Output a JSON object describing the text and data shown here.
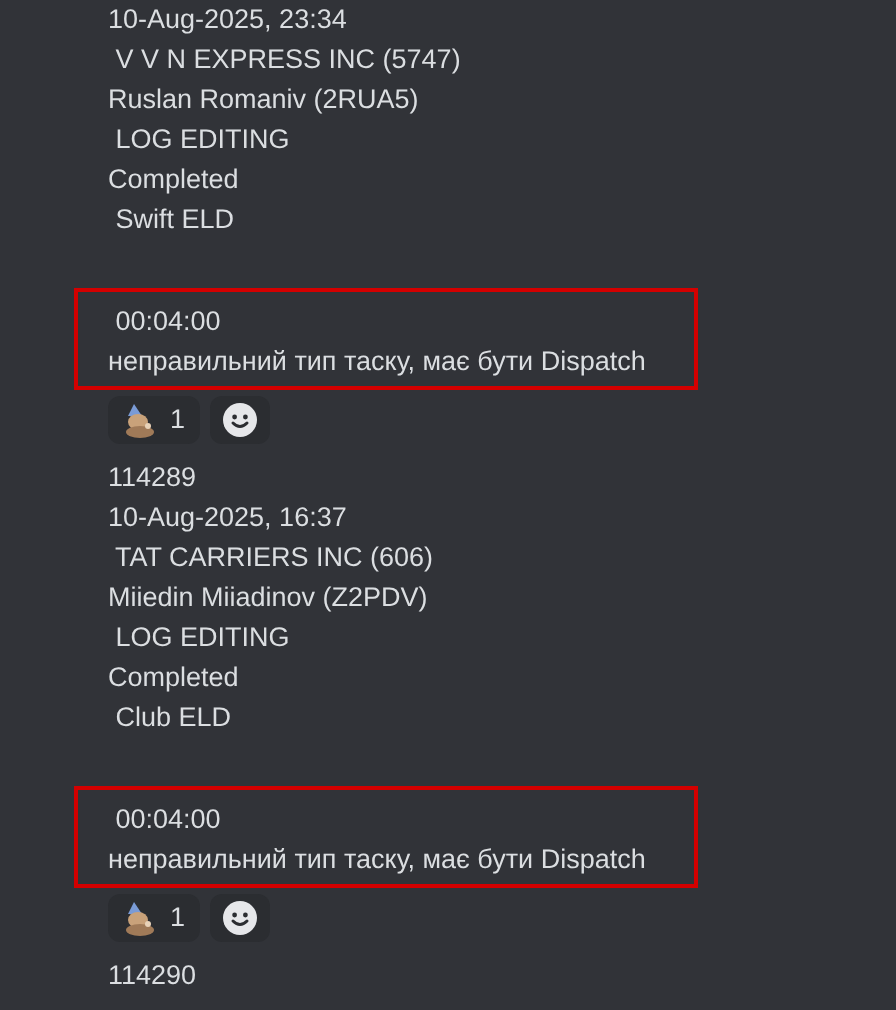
{
  "messages": [
    {
      "lines": [
        "10-Aug-2025, 23:34",
        " V V N EXPRESS INC (5747)",
        "Ruslan Romaniv (2RUA5)",
        " LOG EDITING",
        "Completed",
        " Swift ELD"
      ],
      "note": {
        "highlighted": true,
        "lines": [
          " 00:04:00",
          "неправильний тип таску, має бути Dispatch"
        ]
      },
      "reactions": [
        {
          "count": "1",
          "selected": false
        }
      ]
    },
    {
      "lines": [
        "114289",
        "10-Aug-2025, 16:37",
        " TAT CARRIERS INC (606)",
        "Miiedin Miiadinov (Z2PDV)",
        " LOG EDITING",
        "Completed",
        " Club ELD"
      ],
      "note": {
        "highlighted": true,
        "lines": [
          " 00:04:00",
          "неправильний тип таску, має бути Dispatch"
        ]
      },
      "reactions": [
        {
          "count": "1",
          "selected": false
        }
      ]
    },
    {
      "lines": [
        "114290"
      ]
    }
  ]
}
